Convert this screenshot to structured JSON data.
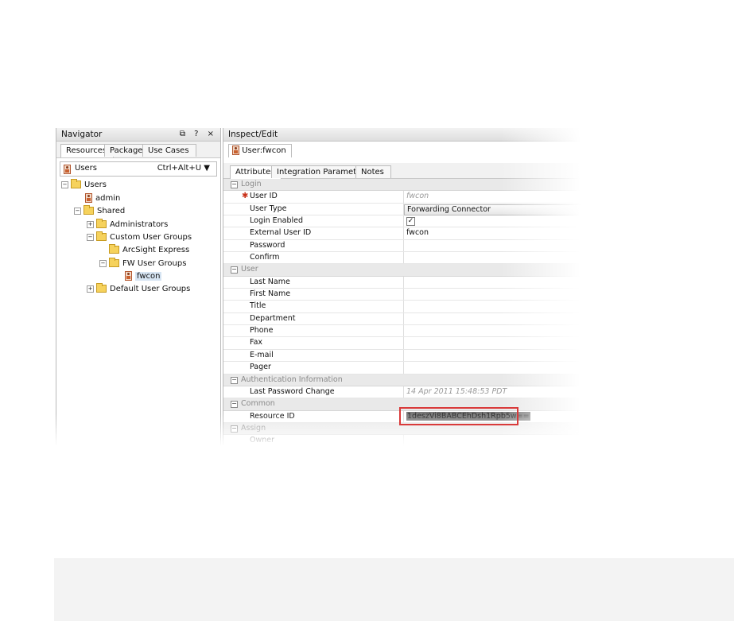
{
  "navigator": {
    "title": "Navigator",
    "controls": "⧉ ? ×",
    "tabs": [
      "Resources",
      "Packages",
      "Use Cases"
    ],
    "selector": {
      "label": "Users",
      "shortcut": "Ctrl+Alt+U"
    },
    "tree": [
      {
        "label": "Users",
        "icon": "folder-open-icon",
        "expander": "−"
      },
      {
        "label": "admin",
        "icon": "user-icon"
      },
      {
        "label": "Shared",
        "icon": "folder-open-icon",
        "expander": "−"
      },
      {
        "label": "Administrators",
        "icon": "folder-icon",
        "expander": "+"
      },
      {
        "label": "Custom User Groups",
        "icon": "folder-open-icon",
        "expander": "−"
      },
      {
        "label": "ArcSight Express",
        "icon": "folder-open-icon"
      },
      {
        "label": "FW User Groups",
        "icon": "folder-open-icon",
        "expander": "−"
      },
      {
        "label": "fwcon",
        "icon": "user-icon",
        "selected": true
      },
      {
        "label": "Default User Groups",
        "icon": "folder-icon",
        "expander": "+"
      }
    ]
  },
  "inspect": {
    "title": "Inspect/Edit",
    "resource_tab": "User:fwcon",
    "attr_tabs": [
      "Attributes",
      "Integration Parameters",
      "Notes"
    ],
    "rows": [
      {
        "type": "section",
        "label": "Login"
      },
      {
        "label": "User ID",
        "value": "fwcon",
        "required": true,
        "muted": true
      },
      {
        "label": "User Type",
        "value": "Forwarding Connector",
        "dropdown": true
      },
      {
        "label": "Login Enabled",
        "value": "✓",
        "checkbox": true
      },
      {
        "label": "External User ID",
        "value": "fwcon"
      },
      {
        "label": "Password",
        "value": ""
      },
      {
        "label": "Confirm",
        "value": ""
      },
      {
        "type": "section",
        "label": "User"
      },
      {
        "label": "Last Name",
        "value": ""
      },
      {
        "label": "First Name",
        "value": ""
      },
      {
        "label": "Title",
        "value": ""
      },
      {
        "label": "Department",
        "value": ""
      },
      {
        "label": "Phone",
        "value": ""
      },
      {
        "label": "Fax",
        "value": ""
      },
      {
        "label": "E-mail",
        "value": ""
      },
      {
        "label": "Pager",
        "value": ""
      },
      {
        "type": "section",
        "label": "Authentication Information"
      },
      {
        "label": "Last Password Change",
        "value": "14 Apr 2011 15:48:53 PDT",
        "muted": true
      },
      {
        "type": "section",
        "label": "Common"
      },
      {
        "label": "Resource ID",
        "value": "1deszVi8BABCEhDsh1Rpb5w==",
        "selected_text": true
      },
      {
        "type": "section",
        "label": "Assign"
      },
      {
        "label": "Owner",
        "value": ""
      }
    ]
  },
  "colors": {
    "highlight": "#d93a3a",
    "required": "#c9321a"
  }
}
